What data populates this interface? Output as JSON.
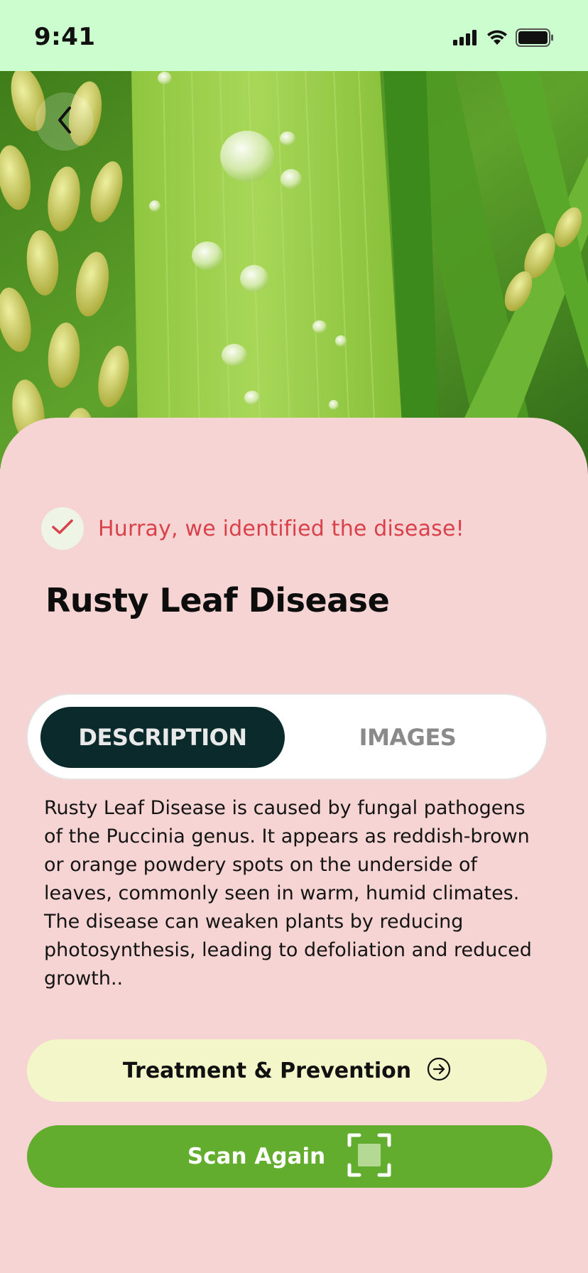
{
  "status_bar": {
    "time": "9:41",
    "signal_icon": "cellular-signal-icon",
    "wifi_icon": "wifi-icon",
    "battery_icon": "battery-icon"
  },
  "hero": {
    "image": "rice-leaf-with-water-droplets",
    "back_icon": "chevron-left-icon"
  },
  "result": {
    "check_icon": "check-icon",
    "message": "Hurray, we identified the disease!",
    "disease_name": "Rusty Leaf Disease"
  },
  "tabs": [
    {
      "label": "DESCRIPTION",
      "active": true
    },
    {
      "label": "IMAGES",
      "active": false
    }
  ],
  "description": "Rusty Leaf Disease is caused by fungal pathogens of the Puccinia genus. It appears as reddish-brown or orange powdery spots on the underside of leaves, commonly seen in warm, humid climates. The disease can weaken plants by reducing photosynthesis, leading to defoliation and reduced growth..",
  "actions": {
    "treatment_label": "Treatment & Prevention",
    "treatment_icon": "arrow-right-circle-icon",
    "scan_label": "Scan Again",
    "scan_icon": "scan-frame-icon"
  },
  "colors": {
    "status_bar_bg": "#ccfdce",
    "sheet_bg": "#f6d4d4",
    "success_text": "#d9414a",
    "active_tab_bg": "#0a2a2b",
    "treatment_bg": "#f2f6c8",
    "scan_bg": "#62ad2e"
  }
}
